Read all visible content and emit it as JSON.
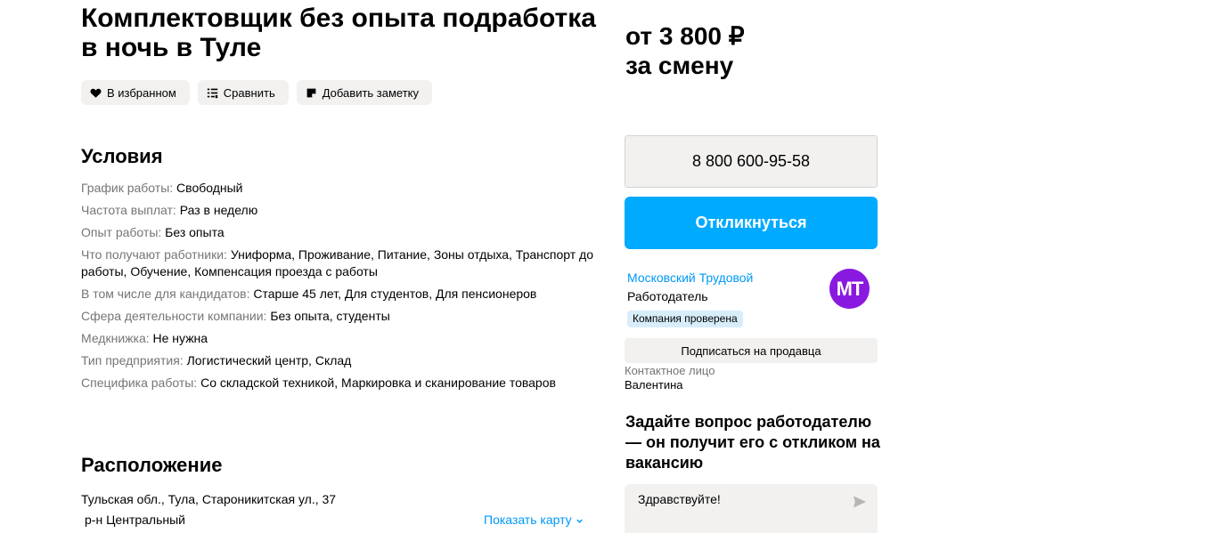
{
  "vacancy": {
    "title": "Комплектовщик без опыта подработка в ночь в Туле",
    "price_line1": "от 3 800 ₽",
    "price_line2": "за смену"
  },
  "actions": {
    "favorite_label": "В избранном",
    "compare_label": "Сравнить",
    "note_label": "Добавить заметку"
  },
  "conditions": {
    "title": "Условия",
    "rows": [
      {
        "key": "График работы: ",
        "value": "Свободный"
      },
      {
        "key": "Частота выплат: ",
        "value": "Раз в неделю"
      },
      {
        "key": "Опыт работы: ",
        "value": "Без опыта"
      },
      {
        "key": "Что получают работники: ",
        "value": "Униформа, Проживание, Питание, Зоны отдыха, Транспорт до работы, Обучение, Компенсация проезда с работы"
      },
      {
        "key": "В том числе для кандидатов: ",
        "value": "Старше 45 лет, Для студентов, Для пенсионеров"
      },
      {
        "key": "Сфера деятельности компании: ",
        "value": "Без опыта, студенты"
      },
      {
        "key": "Медкнижка: ",
        "value": "Не нужна"
      },
      {
        "key": "Тип предприятия: ",
        "value": "Логистический центр, Склад"
      },
      {
        "key": "Специфика работы: ",
        "value": "Со складской техникой, Маркировка и сканирование товаров"
      }
    ]
  },
  "location": {
    "title": "Расположение",
    "address": "Тульская обл., Тула, Староникитская ул., 37",
    "district": "р-н Центральный",
    "show_map_label": "Показать карту"
  },
  "contact": {
    "phone": "8 800 600-95-58",
    "respond_label": "Откликнуться",
    "seller_name": "Московский Трудовой",
    "seller_role": "Работодатель",
    "verified_badge": "Компания проверена",
    "logo_text": "МТ",
    "subscribe_label": "Подписаться на продавца",
    "contact_person_label": "Контактное лицо",
    "contact_person_name": "Валентина"
  },
  "ask": {
    "title": "Задайте вопрос работодателю — он получит его с откликом на вакансию",
    "message_value": "Здравствуйте!"
  },
  "colors": {
    "accent_blue": "#00aaff",
    "link_blue": "#0099f7",
    "logo_purple": "#8a19e0",
    "button_gray": "#f2f1f0"
  }
}
